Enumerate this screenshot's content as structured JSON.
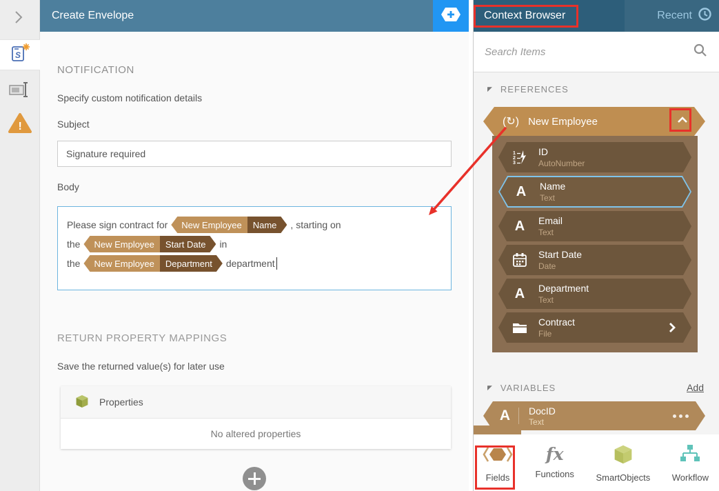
{
  "colors": {
    "header_teal": "#4d7f9d",
    "context_header_teal": "#2d5e7a",
    "accent_blue": "#2196f3",
    "annotation_red": "#e8312a",
    "token_light": "#bf9159",
    "token_dark": "#77522e",
    "reference_tan": "#bf8e51",
    "field_panel_brown": "#8a6e52",
    "field_item_brown": "#6d563c",
    "variable_tan": "#b0895a",
    "smartobject_olive": "#9aa33f",
    "workflow_teal": "#5fc3b9",
    "warning_orange": "#e0993e"
  },
  "icons": {
    "rail": [
      "chevron-right-icon",
      "workflow-step-icon",
      "text-field-icon",
      "warning-triangle-icon"
    ],
    "header_add": "hexagon-plus-icon",
    "recent": "clock-icon",
    "search": "magnifier-icon",
    "reference_group": "reference-refresh-icon",
    "collapse_group": "chevron-up-icon",
    "autonumber": "autonumber-123-icon",
    "text_type": "letter-a-icon",
    "date_type": "calendar-icon",
    "file_type": "folder-icon",
    "drilldown": "chevron-right-icon",
    "variable_menu": "ellipsis-icon",
    "properties": "cube-icon",
    "add_mapping": "plus-circle-icon",
    "toolbar": [
      "hexagon-brackets-icon",
      "fx-icon",
      "cube-icon",
      "org-chart-icon"
    ]
  },
  "header": {
    "title": "Create Envelope"
  },
  "notification": {
    "section_title": "NOTIFICATION",
    "description": "Specify custom notification details",
    "subject_label": "Subject",
    "subject_value": "Signature required",
    "body_label": "Body",
    "body_lines": [
      {
        "prefix": "Please sign contract for",
        "token_scope": "New Employee",
        "token_field": "Name",
        "suffix": ", starting on"
      },
      {
        "prefix": "the",
        "token_scope": "New Employee",
        "token_field": "Start Date",
        "suffix": "in"
      },
      {
        "prefix": "the",
        "token_scope": "New Employee",
        "token_field": "Department",
        "suffix": "department"
      }
    ]
  },
  "return_mappings": {
    "section_title": "RETURN PROPERTY MAPPINGS",
    "description": "Save the returned value(s) for later use",
    "table_header": "Properties",
    "empty_message": "No altered properties"
  },
  "context_browser": {
    "title": "Context Browser",
    "recent_label": "Recent",
    "search_placeholder": "Search Items",
    "references_title": "REFERENCES",
    "reference_group": "New Employee",
    "fields": [
      {
        "name": "ID",
        "type": "AutoNumber"
      },
      {
        "name": "Name",
        "type": "Text"
      },
      {
        "name": "Email",
        "type": "Text"
      },
      {
        "name": "Start Date",
        "type": "Date"
      },
      {
        "name": "Department",
        "type": "Text"
      },
      {
        "name": "Contract",
        "type": "File"
      }
    ],
    "variables_title": "VARIABLES",
    "add_label": "Add",
    "variables": [
      {
        "name": "DocID",
        "type": "Text"
      }
    ],
    "toolbar": [
      {
        "label": "Fields"
      },
      {
        "label": "Functions"
      },
      {
        "label": "SmartObjects"
      },
      {
        "label": "Workflow"
      }
    ]
  }
}
